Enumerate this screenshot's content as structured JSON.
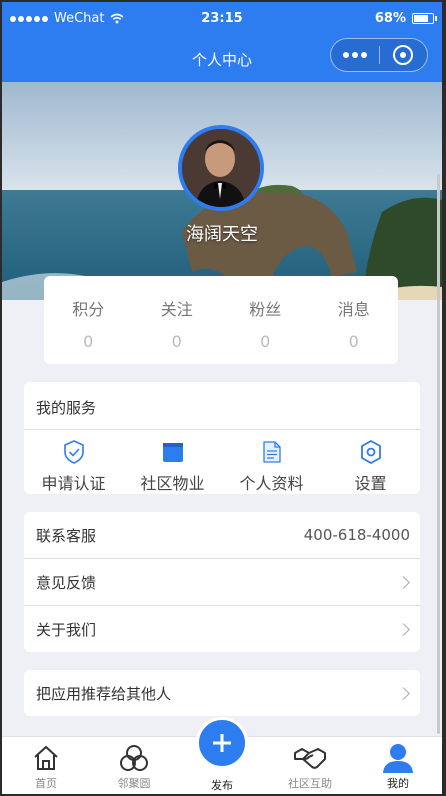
{
  "status_bar": {
    "carrier": "WeChat",
    "time": "23:15",
    "battery": "68%",
    "battery_level": 0.68
  },
  "nav": {
    "title": "个人中心"
  },
  "profile": {
    "username": "海阔天空"
  },
  "stats": [
    {
      "label": "积分",
      "value": "0"
    },
    {
      "label": "关注",
      "value": "0"
    },
    {
      "label": "粉丝",
      "value": "0"
    },
    {
      "label": "消息",
      "value": "0"
    }
  ],
  "services": {
    "title": "我的服务",
    "items": [
      {
        "label": "申请认证",
        "icon": "shield-check-icon"
      },
      {
        "label": "社区物业",
        "icon": "folder-icon"
      },
      {
        "label": "个人资料",
        "icon": "document-icon"
      },
      {
        "label": "设置",
        "icon": "hex-gear-icon"
      }
    ]
  },
  "links": [
    {
      "label": "联系客服",
      "value": "400-618-4000"
    },
    {
      "label": "意见反馈"
    },
    {
      "label": "关于我们"
    }
  ],
  "share": {
    "label": "把应用推荐给其他人"
  },
  "tabbar": [
    {
      "label": "首页",
      "icon": "home-icon"
    },
    {
      "label": "邻聚圆",
      "icon": "circles-icon"
    },
    {
      "label": "发布",
      "icon": "plus-icon"
    },
    {
      "label": "社区互助",
      "icon": "handshake-icon"
    },
    {
      "label": "我的",
      "icon": "user-icon"
    }
  ],
  "colors": {
    "accent": "#2d7cf0",
    "background": "#eef0f5"
  }
}
